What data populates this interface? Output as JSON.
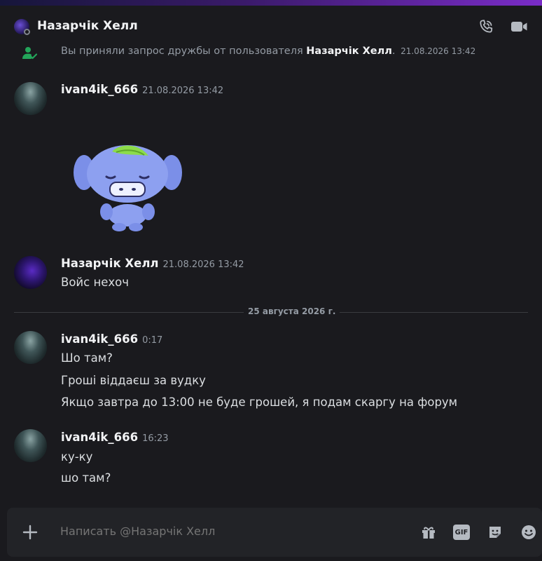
{
  "header": {
    "title": "Назарчік Хелл",
    "call_icon": "phone-call-icon",
    "video_icon": "video-camera-icon"
  },
  "system_message": {
    "prefix": "Вы приняли запрос дружбы от пользователя ",
    "user": "Назарчік Хелл",
    "suffix": ".",
    "timestamp": "21.08.2026 13:42",
    "icon": "friend-accepted-icon"
  },
  "messages": [
    {
      "author": "ivan4ik_666",
      "time": "21.08.2026 13:42",
      "sticker": "blue-mascot-sticker",
      "lines": []
    },
    {
      "author": "Назарчік Хелл",
      "time": "21.08.2026 13:42",
      "lines": [
        "Войс нехоч"
      ]
    },
    {
      "author": "ivan4ik_666",
      "time": "0:17",
      "lines": [
        "Шо там?",
        "Гроші віддаєш за вудку",
        "Якщо завтра до 13:00 не буде грошей, я подам скаргу на форум"
      ]
    },
    {
      "author": "ivan4ik_666",
      "time": "16:23",
      "lines": [
        "ку-ку",
        "шо там?"
      ]
    }
  ],
  "divider": {
    "label": "25 августа 2026 г."
  },
  "composer": {
    "placeholder": "Написать @Назарчік Хелл",
    "icons": [
      "plus-icon",
      "gift-icon",
      "gif-icon",
      "sticker-icon",
      "emoji-icon"
    ],
    "gif_label": "GIF"
  },
  "colors": {
    "background": "#1a1a1e",
    "accent": "#7a2cc8",
    "friend_icon": "#23a55a"
  }
}
